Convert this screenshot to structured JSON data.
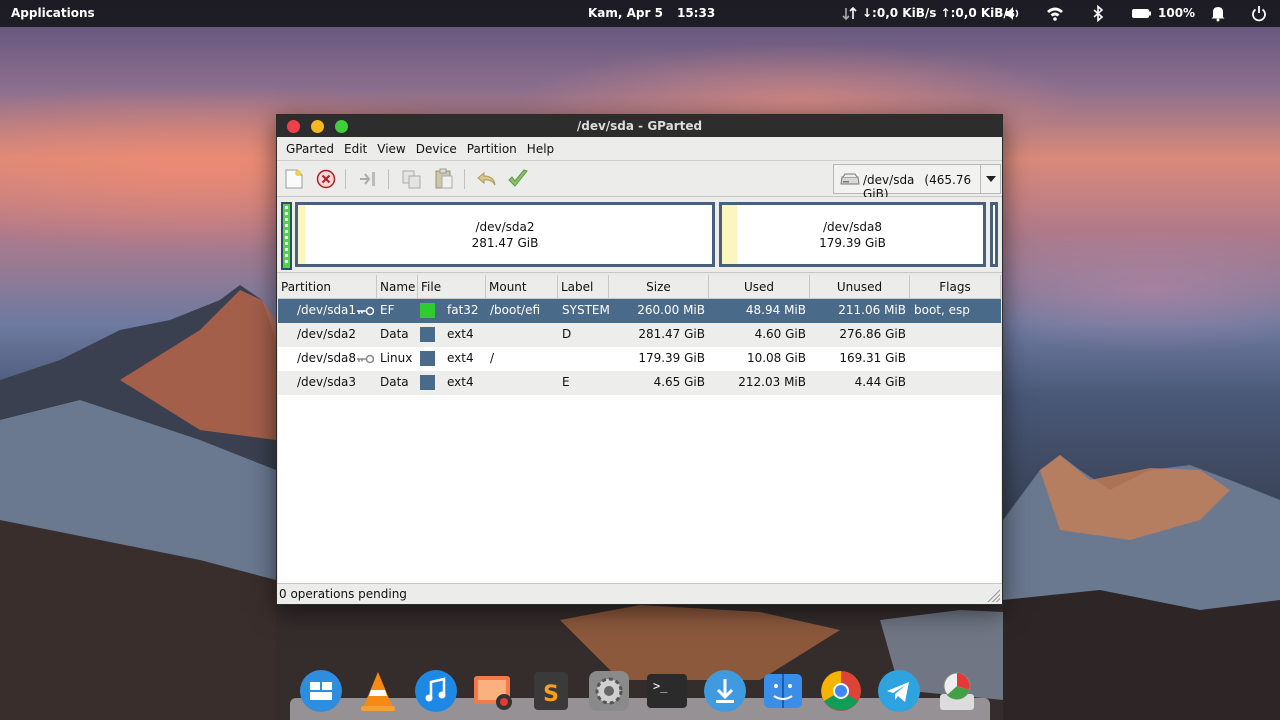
{
  "top_panel": {
    "applications": "Applications",
    "date": "Kam, Apr 5",
    "time": "15:33",
    "network_speed": "↓:0,0 KiB/s ↑:0,0 KiB/s",
    "battery": "100%",
    "icons": [
      "network-activity-icon",
      "volume-icon",
      "wifi-icon",
      "bluetooth-icon",
      "battery-icon",
      "notification-bell-icon",
      "power-icon"
    ]
  },
  "window": {
    "title": "/dev/sda - GParted",
    "menu": [
      "GParted",
      "Edit",
      "View",
      "Device",
      "Partition",
      "Help"
    ],
    "toolbar": {
      "icons": [
        "new-partition-icon",
        "delete-partition-icon",
        "resize-move-icon",
        "copy-icon",
        "paste-icon",
        "undo-icon",
        "apply-icon"
      ]
    },
    "device_selector": {
      "device": "/dev/sda",
      "size": "(465.76 GiB)"
    },
    "disk_map": [
      {
        "name": "/dev/sda2",
        "size": "281.47 GiB",
        "used_fraction": 0.016
      },
      {
        "name": "/dev/sda8",
        "size": "179.39 GiB",
        "used_fraction": 0.056
      }
    ],
    "columns": [
      "Partition",
      "Name",
      "File System",
      "Mount Point",
      "Label",
      "Size",
      "Used",
      "Unused",
      "Flags"
    ],
    "rows": [
      {
        "partition": "/dev/sda1",
        "locked": true,
        "name": "EF",
        "fs_color": "#2ecc2e",
        "fs": "fat32",
        "mount": "/boot/efi",
        "label": "SYSTEM",
        "size": "260.00 MiB",
        "used": "48.94 MiB",
        "unused": "211.06 MiB",
        "flags": "boot, esp"
      },
      {
        "partition": "/dev/sda2",
        "locked": false,
        "name": "Data",
        "fs_color": "#4a6a8a",
        "fs": "ext4",
        "mount": "",
        "label": "D",
        "size": "281.47 GiB",
        "used": "4.60 GiB",
        "unused": "276.86 GiB",
        "flags": ""
      },
      {
        "partition": "/dev/sda8",
        "locked": true,
        "name": "Linux",
        "fs_color": "#4a6a8a",
        "fs": "ext4",
        "mount": "/",
        "label": "",
        "size": "179.39 GiB",
        "used": "10.08 GiB",
        "unused": "169.31 GiB",
        "flags": ""
      },
      {
        "partition": "/dev/sda3",
        "locked": false,
        "name": "Data",
        "fs_color": "#4a6a8a",
        "fs": "ext4",
        "mount": "",
        "label": "E",
        "size": "4.65 GiB",
        "used": "212.03 MiB",
        "unused": "4.44 GiB",
        "flags": ""
      }
    ],
    "status": "0 operations pending"
  },
  "dock": {
    "icons": [
      "multitasking-view-icon",
      "vlc-icon",
      "music-icon",
      "screenshot-icon",
      "sublime-text-icon",
      "system-settings-icon",
      "terminal-icon",
      "app-center-icon",
      "files-icon",
      "chrome-icon",
      "telegram-icon",
      "gparted-icon"
    ]
  }
}
